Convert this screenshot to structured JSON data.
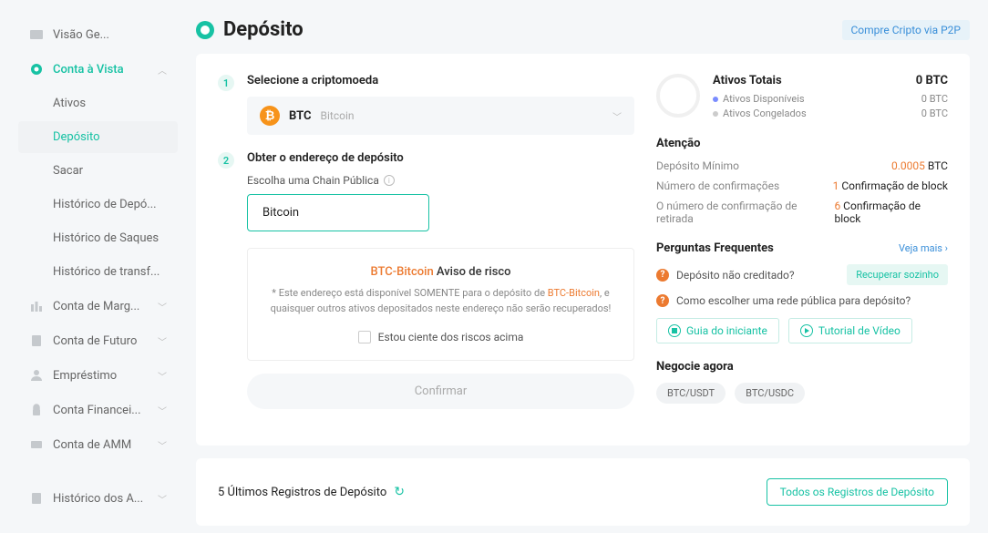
{
  "sidebar": {
    "overview": "Visão Ge...",
    "spot": "Conta à Vista",
    "assets": "Ativos",
    "deposit": "Depósito",
    "withdraw": "Sacar",
    "depositHistory": "Histórico de Depó...",
    "withdrawHistory": "Histórico de Saques",
    "transferHistory": "Histórico de transf...",
    "margin": "Conta de Marg...",
    "futures": "Conta de Futuro",
    "loan": "Empréstimo",
    "finance": "Conta Financei...",
    "amm": "Conta de AMM",
    "accountHistory": "Histórico dos A..."
  },
  "header": {
    "title": "Depósito",
    "p2pLink": "Compre Cripto via P2P"
  },
  "step1": {
    "title": "Selecione a criptomoeda",
    "coinSymbol": "₿",
    "coinCode": "BTC",
    "coinName": "Bitcoin"
  },
  "step2": {
    "title": "Obter o endereço de depósito",
    "chainLabel": "Escolha uma Chain Pública",
    "chainOption": "Bitcoin",
    "riskHighlight": "BTC-Bitcoin",
    "riskTitleSuffix": " Aviso de risco",
    "riskTextPrefix": "* Este endereço está disponível SOMENTE para o depósito de ",
    "riskTextHighlight": "BTC-Bitcoin",
    "riskTextSuffix": ", e quaisquer outros ativos depositados neste endereço não serão recuperados!",
    "checkboxLabel": "Estou ciente dos riscos acima",
    "confirmBtn": "Confirmar"
  },
  "summary": {
    "title": "Ativos Totais",
    "totalValue": "0 BTC",
    "availableLabel": "Ativos Disponíveis",
    "availableValue": "0 BTC",
    "frozenLabel": "Ativos Congelados",
    "frozenValue": "0 BTC"
  },
  "attention": {
    "title": "Atenção",
    "minDepositLabel": "Depósito Mínimo",
    "minDepositValue": "0.0005",
    "minDepositUnit": " BTC",
    "confirmationsLabel": "Número de confirmações",
    "confirmationsNum": "1",
    "confirmationsText": " Confirmação de block",
    "withdrawConfLabel": "O número de confirmação de retirada",
    "withdrawConfNum": "6",
    "withdrawConfText": " Confirmação de block"
  },
  "faq": {
    "title": "Perguntas Frequentes",
    "seeMore": "Veja mais ›",
    "q1": "Depósito não creditado?",
    "recover": "Recuperar sozinho",
    "q2": "Como escolher uma rede pública para depósito?",
    "beginnerGuide": "Guia do iniciante",
    "videoTutorial": "Tutorial de Vídeo"
  },
  "trade": {
    "title": "Negocie agora",
    "pair1": "BTC/USDT",
    "pair2": "BTC/USDC"
  },
  "history": {
    "title": "5 Últimos Registros de Depósito",
    "allBtn": "Todos os Registros de Depósito"
  }
}
